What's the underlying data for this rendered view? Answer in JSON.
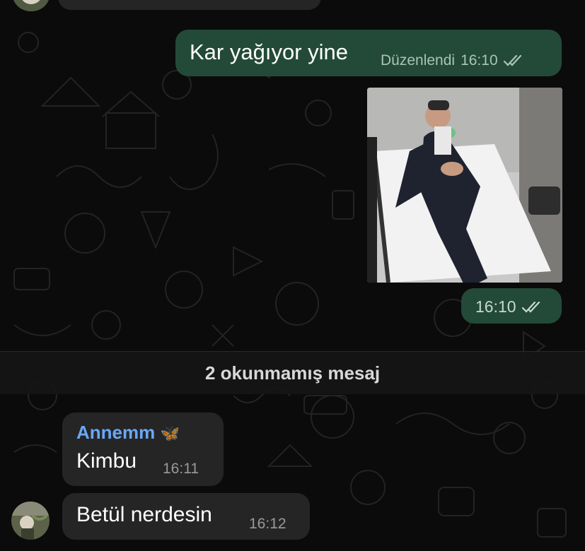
{
  "messages": {
    "outgoing_1": {
      "text": "Kar yağıyor yine",
      "edited_label": "Düzenlendi",
      "time": "16:10",
      "status": "read"
    },
    "outgoing_photo": {
      "time": "16:10",
      "status": "read"
    },
    "incoming_1": {
      "sender": "Annemm",
      "sender_emoji": "🦋",
      "text": "Kimbu",
      "time": "16:11"
    },
    "incoming_2": {
      "text": "Betül nerdesin",
      "time": "16:12"
    }
  },
  "unread_divider": {
    "label": "2 okunmamış mesaj"
  },
  "colors": {
    "outgoing_bubble": "#234a38",
    "incoming_bubble": "#252525",
    "sender_name": "#6aa7f5",
    "background": "#0b0b0b"
  }
}
